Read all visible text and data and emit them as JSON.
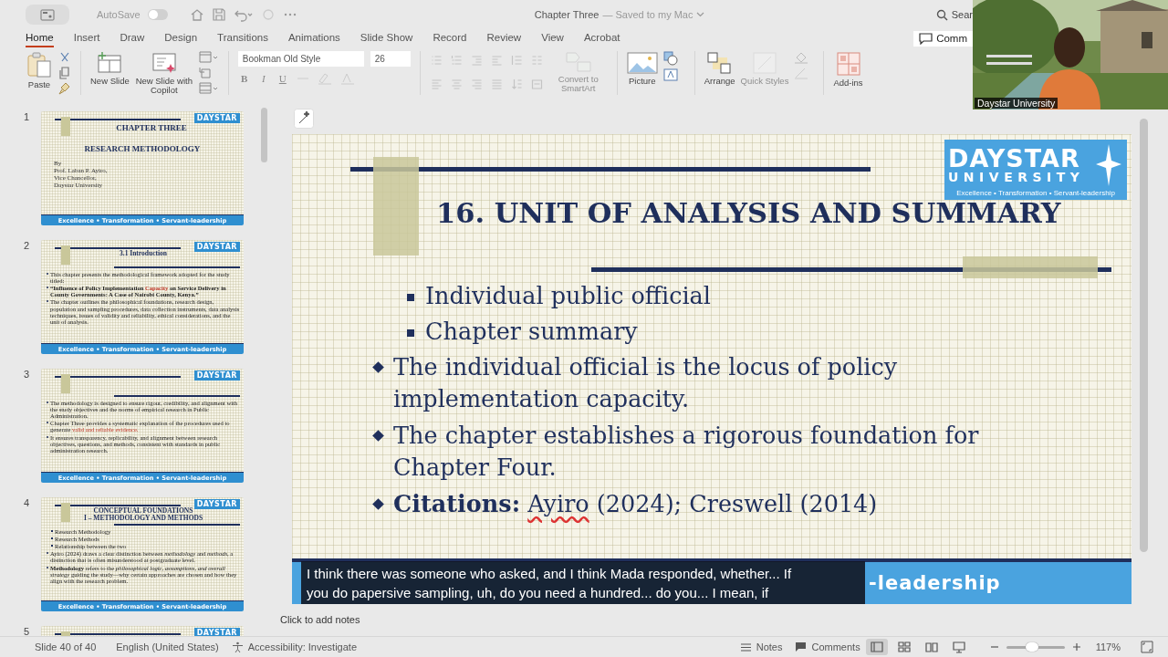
{
  "title_bar": {
    "autosave_label": "AutoSave",
    "autosave_on": false,
    "document_title": "Chapter Three",
    "save_status": "— Saved to my Mac",
    "search": "Sear"
  },
  "tabs": [
    {
      "label": "Home",
      "selected": true
    },
    {
      "label": "Insert",
      "selected": false
    },
    {
      "label": "Draw",
      "selected": false
    },
    {
      "label": "Design",
      "selected": false
    },
    {
      "label": "Transitions",
      "selected": false
    },
    {
      "label": "Animations",
      "selected": false
    },
    {
      "label": "Slide Show",
      "selected": false
    },
    {
      "label": "Record",
      "selected": false
    },
    {
      "label": "Review",
      "selected": false
    },
    {
      "label": "View",
      "selected": false
    },
    {
      "label": "Acrobat",
      "selected": false
    }
  ],
  "comments_button": "Comm",
  "ribbon": {
    "paste": {
      "label": "Paste",
      "disabled": false
    },
    "new_slide": [
      {
        "kind": "new",
        "label": "New Slide",
        "disabled": false
      },
      {
        "kind": "copilot",
        "label": "New Slide with Copilot",
        "disabled": false
      }
    ],
    "font": "Bookman Old Style",
    "size": "26",
    "format_buttons": [
      "B",
      "I",
      "U"
    ],
    "smartart": {
      "label": "Convert to SmartArt",
      "disabled": true
    },
    "picture": {
      "label": "Picture",
      "disabled": false
    },
    "arrange": [
      {
        "kind": "arrange",
        "label": "Arrange",
        "disabled": false
      },
      {
        "kind": "styles",
        "label": "Quick Styles",
        "disabled": true
      }
    ],
    "addins": {
      "label": "Add-ins",
      "disabled": false
    }
  },
  "thumbnails": [
    {
      "number": "1",
      "kind": "cover",
      "logo": "DAYSTAR",
      "title": "CHAPTER THREE",
      "subtitle": "RESEARCH METHODOLOGY",
      "byline": [
        "By",
        "Prof. Laban P. Ayiro,",
        "Vice Chancellor,",
        "Daystar University"
      ],
      "footer": "Excellence • Transformation • Servant-leadership"
    },
    {
      "number": "2",
      "kind": "content",
      "logo": "DAYSTAR",
      "title": [
        "3.1 Introduction"
      ],
      "bullets": [
        {
          "kind": "main",
          "parts": [
            {
              "kind": "plain",
              "text": "This chapter presents the methodological framework adopted for the study titled:"
            }
          ]
        },
        {
          "kind": "main",
          "parts": [
            {
              "kind": "plain",
              "text": "**“Influence of Policy Implementation** "
            },
            {
              "kind": "accent",
              "text": "**Capacity**"
            },
            {
              "kind": "plain",
              "text": " **on Service Delivery in County Governments: A Case of Nairobi County, Kenya.”**"
            }
          ]
        },
        {
          "kind": "main",
          "parts": [
            {
              "kind": "plain",
              "text": "The chapter outlines the philosophical foundations, research design, population and sampling procedures, data collection instruments, data analysis techniques, issues of validity and reliability, ethical considerations, and the unit of analysis."
            }
          ]
        }
      ],
      "footer": "Excellence • Transformation • Servant-leadership"
    },
    {
      "number": "3",
      "kind": "content",
      "logo": "DAYSTAR",
      "bullets": [
        {
          "kind": "main",
          "parts": [
            {
              "kind": "plain",
              "text": "The methodology is designed to ensure rigour, credibility, and alignment with the study objectives and the norms of empirical research in Public Administration."
            }
          ]
        },
        {
          "kind": "main",
          "parts": [
            {
              "kind": "plain",
              "text": "Chapter Three provides a systematic explanation of the procedures used to generate "
            },
            {
              "kind": "accent",
              "text": "valid and reliable evidence."
            }
          ]
        },
        {
          "kind": "main",
          "parts": [
            {
              "kind": "plain",
              "text": "It ensures transparency, replicability, and alignment between research objectives, questions, and methods, consistent with standards in public administration research."
            }
          ]
        }
      ],
      "footer": "Excellence • Transformation • Servant-leadership"
    },
    {
      "number": "4",
      "kind": "content",
      "logo": "DAYSTAR",
      "title": [
        "CONCEPTUAL FOUNDATIONS",
        "I – METHODOLOGY AND METHODS"
      ],
      "bullets": [
        {
          "kind": "sub",
          "parts": [
            {
              "kind": "plain",
              "text": "Research Methodology"
            }
          ]
        },
        {
          "kind": "sub",
          "parts": [
            {
              "kind": "plain",
              "text": "Research Methods"
            }
          ]
        },
        {
          "kind": "sub",
          "parts": [
            {
              "kind": "plain",
              "text": "Relationship between the two"
            }
          ]
        },
        {
          "kind": "main",
          "parts": [
            {
              "kind": "plain",
              "text": "Ayiro (2024) draws a clear distinction between *methodology* and *methods*, a distinction that is often misunderstood at postgraduate level."
            }
          ]
        },
        {
          "kind": "main",
          "parts": [
            {
              "kind": "plain",
              "text": "**Methodology** refers to the *philosophical logic, assumptions, and overall strategy* guiding the study—why certain approaches are chosen and how they align with the research problem."
            }
          ]
        }
      ],
      "footer": "Excellence • Transformation • Servant-leadership"
    },
    {
      "number": "5",
      "kind": "content",
      "logo": "DAYSTAR"
    }
  ],
  "slide": {
    "title": "16. UNIT OF ANALYSIS AND SUMMARY",
    "logo": {
      "name": "DAYSTAR",
      "sub": "UNIVERSITY",
      "motto": "Excellence • Transformation • Servant-leadership"
    },
    "bullets": [
      {
        "kind": "sub",
        "parts": [
          {
            "kind": "plain",
            "text": "Individual public official"
          }
        ]
      },
      {
        "kind": "sub",
        "parts": [
          {
            "kind": "plain",
            "text": "Chapter summary"
          }
        ]
      },
      {
        "kind": "main",
        "parts": [
          {
            "kind": "plain",
            "text": "The individual official is the locus of policy implementation capacity."
          }
        ]
      },
      {
        "kind": "main",
        "parts": [
          {
            "kind": "plain",
            "text": "The chapter establishes a rigorous foundation for Chapter Four."
          }
        ]
      },
      {
        "kind": "main",
        "parts": [
          {
            "kind": "plain",
            "text": "**Citations:** "
          },
          {
            "kind": "flagged",
            "text": "Ayiro"
          },
          {
            "kind": "plain",
            "text": " (2024); Creswell (2014)"
          }
        ]
      }
    ],
    "footer": "-leadership"
  },
  "caption": "I think there was someone who asked, and I think Mada responded, whether... If\nyou do papersive sampling, uh, do you need a hundred... do you... I mean, if",
  "notes_placeholder": "Click to add notes",
  "video": {
    "name": "Daystar University"
  },
  "status_bar": {
    "slide": "Slide 40 of 40",
    "language": "English (United States)",
    "accessibility": "Accessibility: Investigate",
    "notes": "Notes",
    "comments": "Comments",
    "views": [
      {
        "kind": "normal",
        "selected": true
      },
      {
        "kind": "sorter",
        "selected": false
      },
      {
        "kind": "reading",
        "selected": false
      },
      {
        "kind": "show",
        "selected": false
      }
    ],
    "zoom_slider": {
      "level": 0.45
    },
    "zoom": "117%"
  }
}
